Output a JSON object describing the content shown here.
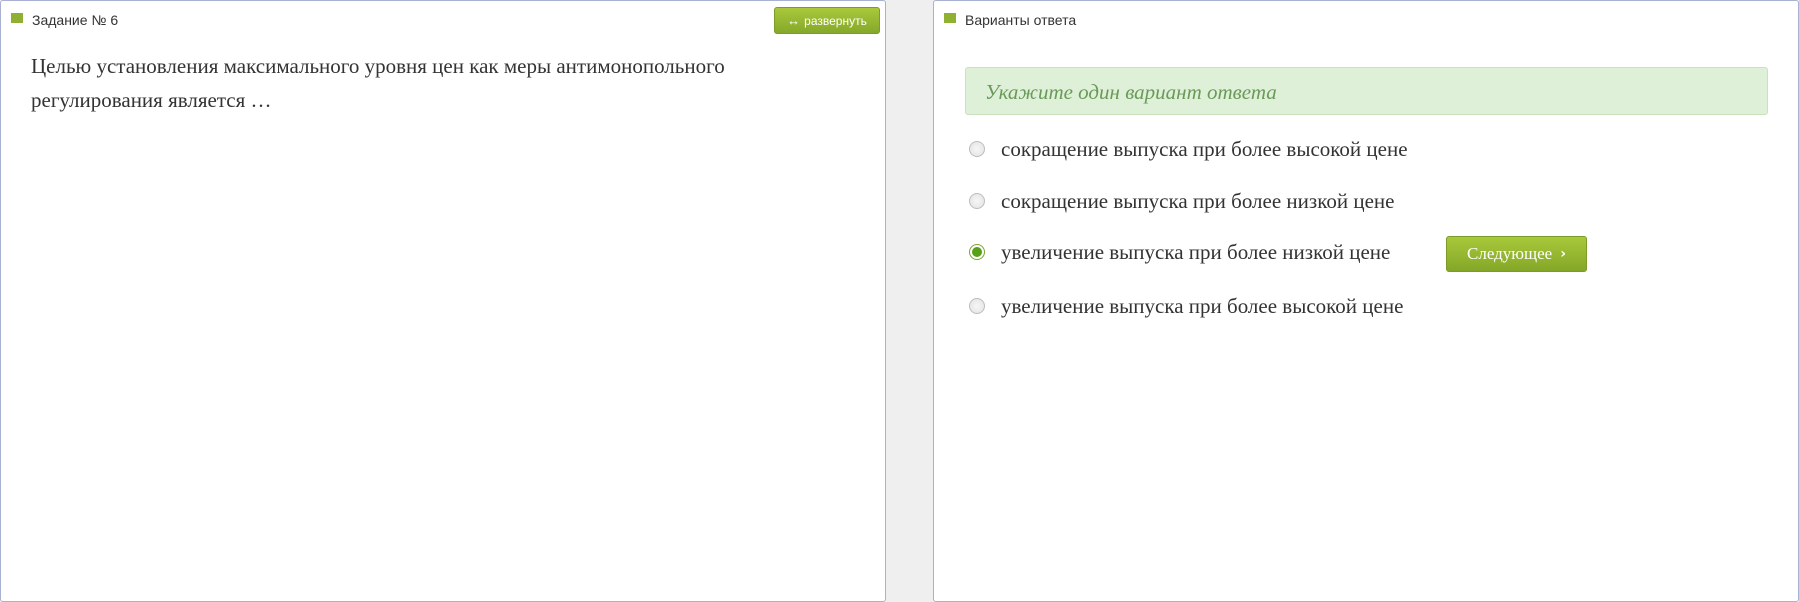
{
  "task_panel": {
    "title": "Задание № 6",
    "expand_label": "развернуть",
    "expand_icon": "↔",
    "question": "Целью установления максимального уровня цен как меры антимонопольного регулирования является …"
  },
  "answers_panel": {
    "title": "Варианты ответа",
    "hint": "Укажите один вариант ответа",
    "options": [
      {
        "label": "сокращение выпуска при более высокой цене",
        "selected": false
      },
      {
        "label": "сокращение выпуска при более низкой цене",
        "selected": false
      },
      {
        "label": "увеличение выпуска при более низкой цене",
        "selected": true
      },
      {
        "label": "увеличение выпуска при более высокой цене",
        "selected": false
      }
    ],
    "next_label": "Следующее",
    "next_icon": "›"
  },
  "colors": {
    "accent_green": "#8fb030",
    "hint_bg": "#dff0d8",
    "panel_border": "#a9b1d3"
  }
}
